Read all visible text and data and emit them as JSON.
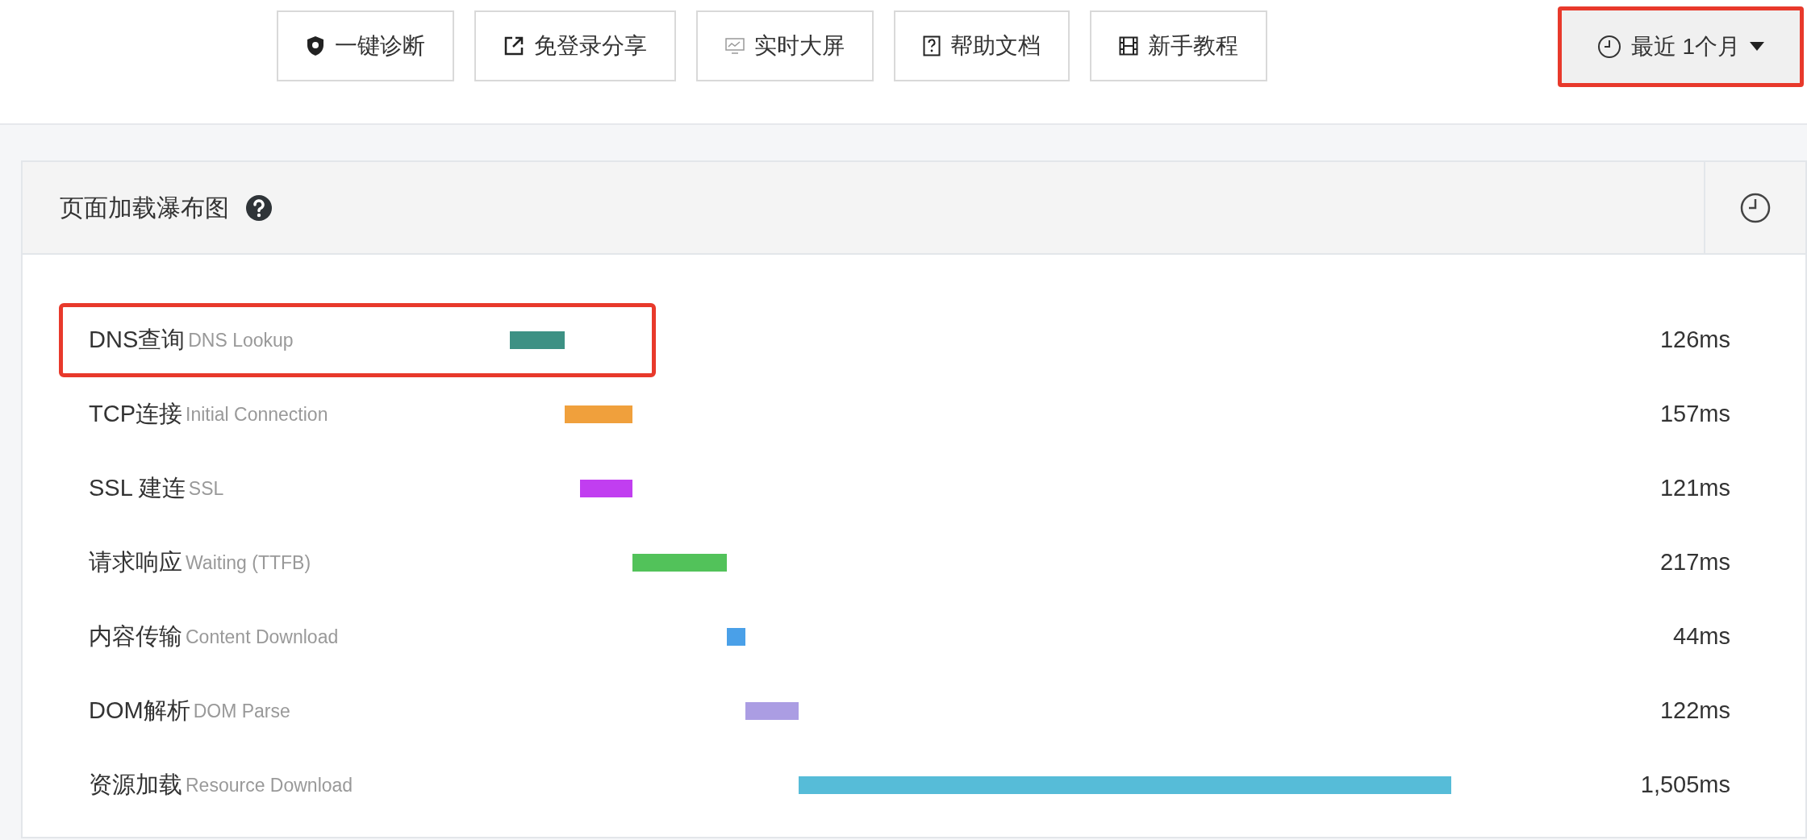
{
  "toolbar": {
    "buttons": [
      {
        "label": "一键诊断",
        "kind": "shield"
      },
      {
        "label": "免登录分享",
        "kind": "share"
      },
      {
        "label": "实时大屏",
        "kind": "monitor"
      },
      {
        "label": "帮助文档",
        "kind": "help"
      },
      {
        "label": "新手教程",
        "kind": "film"
      }
    ],
    "time_range": {
      "label": "最近 1个月",
      "highlighted": true
    }
  },
  "panel": {
    "title": "页面加载瀑布图",
    "rows": [
      {
        "label": "DNS查询",
        "sublabel": "DNS Lookup",
        "value": "126ms",
        "color": "#3d9184",
        "kind": "sequential",
        "highlighted": true
      },
      {
        "label": "TCP连接",
        "sublabel": "Initial Connection",
        "value": "157ms",
        "color": "#f0a03c",
        "kind": "sequential",
        "highlighted": false
      },
      {
        "label": "SSL 建连",
        "sublabel": "SSL",
        "value": "121ms",
        "color": "#c13ef0",
        "kind": "overlap",
        "highlighted": false
      },
      {
        "label": "请求响应",
        "sublabel": "Waiting (TTFB)",
        "value": "217ms",
        "color": "#52c25a",
        "kind": "sequential",
        "highlighted": false
      },
      {
        "label": "内容传输",
        "sublabel": "Content Download",
        "value": "44ms",
        "color": "#4aa0e8",
        "kind": "sequential",
        "highlighted": false
      },
      {
        "label": "DOM解析",
        "sublabel": "DOM Parse",
        "value": "122ms",
        "color": "#ab9de3",
        "kind": "sequential",
        "highlighted": false
      },
      {
        "label": "资源加载",
        "sublabel": "Resource Download",
        "value": "1,505ms",
        "color": "#56bcd8",
        "kind": "sequential",
        "highlighted": false
      }
    ]
  }
}
